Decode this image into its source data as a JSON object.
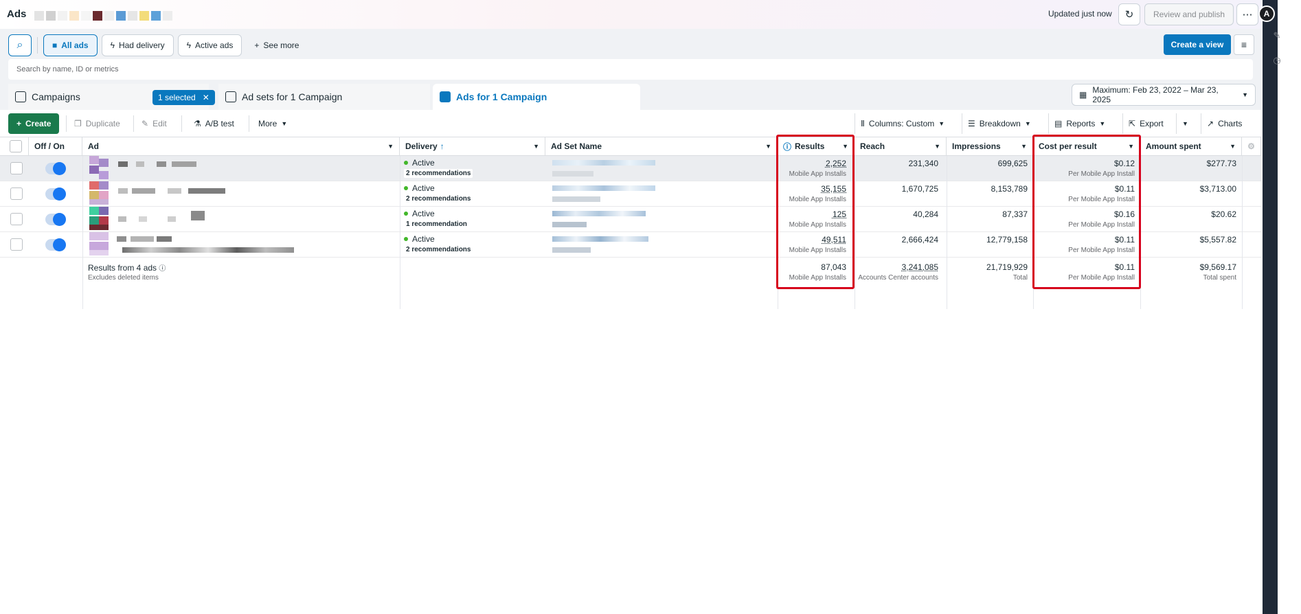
{
  "app": {
    "title": "Ads"
  },
  "header": {
    "updated": "Updated just now",
    "review_label": "Review and publish",
    "more_icon": "ellipsis-icon",
    "refresh_icon": "refresh-icon"
  },
  "filters": {
    "all_ads": "All ads",
    "had_delivery": "Had delivery",
    "active_ads": "Active ads",
    "see_more": "See more",
    "search_placeholder": "Search by name, ID or metrics",
    "create_view": "Create a view"
  },
  "tabs": {
    "campaigns": "Campaigns",
    "selected": "1 selected",
    "adsets": "Ad sets for 1 Campaign",
    "ads": "Ads for 1 Campaign",
    "date_range": "Maximum: Feb 23, 2022 – Mar 23, 2025"
  },
  "toolbar": {
    "create": "Create",
    "duplicate": "Duplicate",
    "edit": "Edit",
    "ab_test": "A/B test",
    "more": "More",
    "columns": "Columns: Custom",
    "breakdown": "Breakdown",
    "reports": "Reports",
    "export": "Export",
    "charts": "Charts"
  },
  "table": {
    "headers": {
      "off_on": "Off / On",
      "ad": "Ad",
      "delivery": "Delivery",
      "ad_set_name": "Ad Set Name",
      "results": "Results",
      "reach": "Reach",
      "impressions": "Impressions",
      "cost_per_result": "Cost per result",
      "amount_spent": "Amount spent"
    },
    "rows": [
      {
        "delivery": "Active",
        "recs": "2 recommendations",
        "results": "2,252",
        "results_sub": "Mobile App Installs",
        "reach": "231,340",
        "impressions": "699,625",
        "cpr": "$0.12",
        "cpr_sub": "Per Mobile App Install",
        "spent": "$277.73"
      },
      {
        "delivery": "Active",
        "recs": "2 recommendations",
        "results": "35,155",
        "results_sub": "Mobile App Installs",
        "reach": "1,670,725",
        "impressions": "8,153,789",
        "cpr": "$0.11",
        "cpr_sub": "Per Mobile App Install",
        "spent": "$3,713.00"
      },
      {
        "delivery": "Active",
        "recs": "1 recommendation",
        "results": "125",
        "results_sub": "Mobile App Installs",
        "reach": "40,284",
        "impressions": "87,337",
        "cpr": "$0.16",
        "cpr_sub": "Per Mobile App Install",
        "spent": "$20.62"
      },
      {
        "delivery": "Active",
        "recs": "2 recommendations",
        "results": "49,511",
        "results_sub": "Mobile App Installs",
        "reach": "2,666,424",
        "impressions": "12,779,158",
        "cpr": "$0.11",
        "cpr_sub": "Per Mobile App Install",
        "spent": "$5,557.82"
      }
    ],
    "summary": {
      "label": "Results from 4 ads",
      "sublabel": "Excludes deleted items",
      "results": "87,043",
      "results_sub": "Mobile App Installs",
      "reach": "3,241,085",
      "reach_sub": "Accounts Center accounts",
      "impressions": "21,719,929",
      "impressions_sub": "Total",
      "cpr": "$0.11",
      "cpr_sub": "Per Mobile App Install",
      "spent": "$9,569.17",
      "spent_sub": "Total spent"
    }
  },
  "colors": {
    "accent": "#0a78be",
    "create_green": "#1a7a4c",
    "highlight": "#d6001c",
    "active_dot": "#42b72a"
  }
}
